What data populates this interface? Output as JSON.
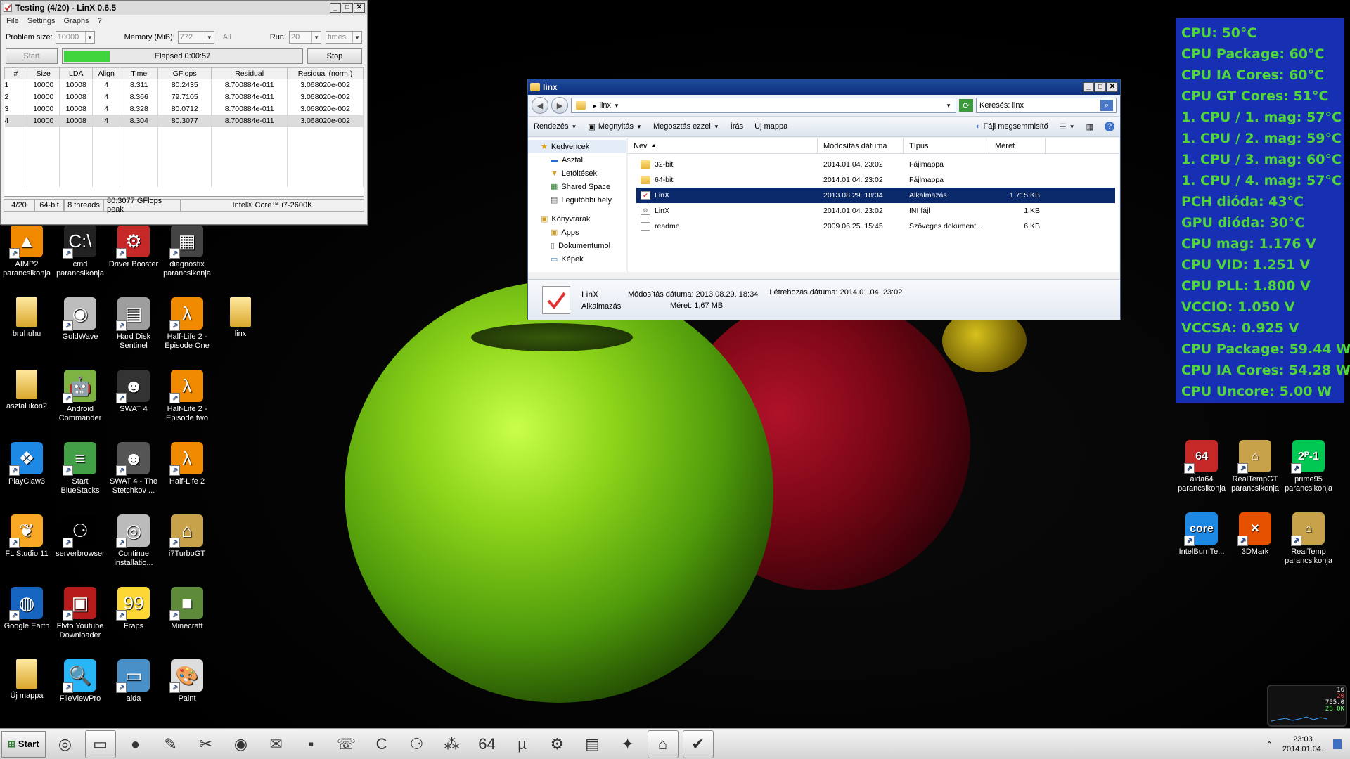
{
  "linx": {
    "title": "Testing (4/20) - LinX 0.6.5",
    "menu": [
      "File",
      "Settings",
      "Graphs",
      "?"
    ],
    "problem_size_label": "Problem size:",
    "problem_size": "10000",
    "memory_label": "Memory (MiB):",
    "memory": "772",
    "all_label": "All",
    "run_label": "Run:",
    "run_value": "20",
    "run_unit": "times",
    "start_label": "Start",
    "stop_label": "Stop",
    "elapsed": "Elapsed 0:00:57",
    "progress": 0.19,
    "columns": [
      "#",
      "Size",
      "LDA",
      "Align",
      "Time",
      "GFlops",
      "Residual",
      "Residual (norm.)"
    ],
    "rows": [
      [
        "1",
        "10000",
        "10008",
        "4",
        "8.311",
        "80.2435",
        "8.700884e-011",
        "3.068020e-002"
      ],
      [
        "2",
        "10000",
        "10008",
        "4",
        "8.366",
        "79.7105",
        "8.700884e-011",
        "3.068020e-002"
      ],
      [
        "3",
        "10000",
        "10008",
        "4",
        "8.328",
        "80.0712",
        "8.700884e-011",
        "3.068020e-002"
      ],
      [
        "4",
        "10000",
        "10008",
        "4",
        "8.304",
        "80.3077",
        "8.700884e-011",
        "3.068020e-002"
      ]
    ],
    "status": [
      "4/20",
      "64-bit",
      "8 threads",
      "80.3077 GFlops peak",
      "Intel® Core™ i7-2600K"
    ]
  },
  "explorer": {
    "title": "linx",
    "address": "linx",
    "search_placeholder": "Keresés: linx",
    "commands": [
      "Rendezés",
      "Megnyitás",
      "Megosztás ezzel",
      "Írás",
      "Új mappa"
    ],
    "burn_label": "Fájl megsemmisítő",
    "nav": {
      "favorites_label": "Kedvencek",
      "favorites": [
        "Asztal",
        "Letöltések",
        "Shared Space",
        "Legutóbbi hely"
      ],
      "libraries_label": "Könyvtárak",
      "libraries": [
        "Apps",
        "Dokumentumol",
        "Képek"
      ]
    },
    "columns": [
      "Név",
      "Módosítás dátuma",
      "Típus",
      "Méret"
    ],
    "files": [
      {
        "name": "32-bit",
        "date": "2014.01.04. 23:02",
        "type": "Fájlmappa",
        "size": "",
        "icon": "folder"
      },
      {
        "name": "64-bit",
        "date": "2014.01.04. 23:02",
        "type": "Fájlmappa",
        "size": "",
        "icon": "folder"
      },
      {
        "name": "LinX",
        "date": "2013.08.29. 18:34",
        "type": "Alkalmazás",
        "size": "1 715 KB",
        "icon": "app"
      },
      {
        "name": "LinX",
        "date": "2014.01.04. 23:02",
        "type": "INI fájl",
        "size": "1 KB",
        "icon": "ini"
      },
      {
        "name": "readme",
        "date": "2009.06.25. 15:45",
        "type": "Szöveges dokument...",
        "size": "6 KB",
        "icon": "txt"
      }
    ],
    "details": {
      "name": "LinX",
      "kind": "Alkalmazás",
      "modified_label": "Módosítás dátuma:",
      "modified": "2013.08.29. 18:34",
      "size_label": "Méret:",
      "size": "1,67 MB",
      "created_label": "Létrehozás dátuma:",
      "created": "2014.01.04. 23:02"
    }
  },
  "sensors": [
    "CPU: 50°C",
    "CPU Package: 60°C",
    "CPU IA Cores: 60°C",
    "CPU GT Cores: 51°C",
    "1. CPU / 1. mag: 57°C",
    "1. CPU / 2. mag: 59°C",
    "1. CPU / 3. mag: 60°C",
    "1. CPU / 4. mag: 57°C",
    "PCH dióda: 43°C",
    "GPU dióda: 30°C",
    "CPU mag: 1.176 V",
    "CPU VID: 1.251 V",
    "CPU PLL: 1.800 V",
    "VCCIO: 1.050 V",
    "VCCSA: 0.925 V",
    "CPU Package: 59.44 W",
    "CPU IA Cores: 54.28 W",
    "CPU Uncore: 5.00 W"
  ],
  "desktop_icons": [
    {
      "label": "AIMP2 parancsikonja",
      "icon": "aimp-icon",
      "glyph": "▲",
      "color": "#f28a00"
    },
    {
      "label": "cmd parancsikonja",
      "icon": "cmd-icon",
      "glyph": "C:\\",
      "color": "#222"
    },
    {
      "label": "Driver Booster",
      "icon": "driver-booster-icon",
      "glyph": "⚙",
      "color": "#c62828"
    },
    {
      "label": "diagnostix parancsikonja",
      "icon": "chip-icon",
      "glyph": "▦",
      "color": "#444"
    },
    {
      "label": "bruhuhu",
      "icon": "folder-icon",
      "glyph": "",
      "color": "#e7c24a"
    },
    {
      "label": "GoldWave",
      "icon": "goldwave-icon",
      "glyph": "◉",
      "color": "#bdbdbd"
    },
    {
      "label": "Hard Disk Sentinel",
      "icon": "hdd-icon",
      "glyph": "▤",
      "color": "#9e9e9e"
    },
    {
      "label": "Half-Life 2 - Episode One",
      "icon": "half-life-icon",
      "glyph": "λ",
      "color": "#f08a00"
    },
    {
      "label": "linx",
      "icon": "folder-icon",
      "glyph": "",
      "color": "#e7c24a"
    },
    {
      "label": "asztal ikon2",
      "icon": "folder-icon",
      "glyph": "",
      "color": "#e7c24a"
    },
    {
      "label": "Android Commander",
      "icon": "android-icon",
      "glyph": "🤖",
      "color": "#7cb342"
    },
    {
      "label": "SWAT 4",
      "icon": "swat-icon",
      "glyph": "☻",
      "color": "#333"
    },
    {
      "label": "Half-Life 2 - Episode two",
      "icon": "half-life-icon",
      "glyph": "λ",
      "color": "#f08a00"
    },
    {
      "label": "PlayClaw3",
      "icon": "playclaw-icon",
      "glyph": "❖",
      "color": "#1e88e5"
    },
    {
      "label": "Start BlueStacks",
      "icon": "bluestacks-icon",
      "glyph": "≡",
      "color": "#43a047"
    },
    {
      "label": "SWAT 4 - The Stetchkov ...",
      "icon": "swat-icon",
      "glyph": "☻",
      "color": "#555"
    },
    {
      "label": "Half-Life 2",
      "icon": "half-life-icon",
      "glyph": "λ",
      "color": "#f08a00"
    },
    {
      "label": "FL Studio 11",
      "icon": "fl-studio-icon",
      "glyph": "❦",
      "color": "#f9a825"
    },
    {
      "label": "serverbrowser",
      "icon": "steam-icon",
      "glyph": "⚆",
      "color": "#000"
    },
    {
      "label": "Continue installatio...",
      "icon": "installer-icon",
      "glyph": "◎",
      "color": "#bbb"
    },
    {
      "label": "i7TurboGT",
      "icon": "i7turbo-icon",
      "glyph": "⌂",
      "color": "#c8a24a"
    },
    {
      "label": "Google Earth",
      "icon": "google-earth-icon",
      "glyph": "◍",
      "color": "#1565c0"
    },
    {
      "label": "Flvto Youtube Downloader",
      "icon": "flvto-icon",
      "glyph": "▣",
      "color": "#b71c1c"
    },
    {
      "label": "Fraps",
      "icon": "fraps-icon",
      "glyph": "99",
      "color": "#fdd835"
    },
    {
      "label": "Minecraft",
      "icon": "minecraft-icon",
      "glyph": "■",
      "color": "#5d8b3a"
    },
    {
      "label": "Új mappa",
      "icon": "folder-icon",
      "glyph": "",
      "color": "#e7c24a"
    },
    {
      "label": "FileViewPro",
      "icon": "fileviewpro-icon",
      "glyph": "🔍",
      "color": "#29b6f6"
    },
    {
      "label": "aida",
      "icon": "image-icon",
      "glyph": "▭",
      "color": "#4a90c8"
    },
    {
      "label": "Paint",
      "icon": "paint-icon",
      "glyph": "🎨",
      "color": "#ddd"
    }
  ],
  "right_icons": [
    {
      "label": "aida64 parancsikonja",
      "icon": "aida64-icon",
      "glyph": "64",
      "color": "#c62828"
    },
    {
      "label": "RealTempGT parancsikonja",
      "icon": "realtemp-icon",
      "glyph": "⌂",
      "color": "#c8a24a"
    },
    {
      "label": "prime95 parancsikonja",
      "icon": "prime95-icon",
      "glyph": "2ᴾ-1",
      "color": "#00c853"
    },
    {
      "label": "IntelBurnTe...",
      "icon": "intel-icon",
      "glyph": "core",
      "color": "#1e88e5"
    },
    {
      "label": "3DMark",
      "icon": "3dmark-icon",
      "glyph": "✕",
      "color": "#e65100"
    },
    {
      "label": "RealTemp parancsikonja",
      "icon": "realtemp-icon",
      "glyph": "⌂",
      "color": "#c8a24a"
    }
  ],
  "taskbar": {
    "start_label": "Start",
    "items": [
      {
        "icon": "network-icon",
        "glyph": "◎"
      },
      {
        "icon": "explorer-icon",
        "glyph": "▭",
        "active": true
      },
      {
        "icon": "firefox-icon",
        "glyph": "●"
      },
      {
        "icon": "paint-icon",
        "glyph": "✎"
      },
      {
        "icon": "tool-icon",
        "glyph": "✂"
      },
      {
        "icon": "chrome-icon",
        "glyph": "◉"
      },
      {
        "icon": "mail-icon",
        "glyph": "✉"
      },
      {
        "icon": "save-icon",
        "glyph": "▪"
      },
      {
        "icon": "viber-icon",
        "glyph": "☏"
      },
      {
        "icon": "ccleaner-icon",
        "glyph": "C"
      },
      {
        "icon": "steam-icon",
        "glyph": "⚆"
      },
      {
        "icon": "network-map-icon",
        "glyph": "⁂"
      },
      {
        "icon": "aida64-icon",
        "glyph": "64"
      },
      {
        "icon": "utorrent-icon",
        "glyph": "µ"
      },
      {
        "icon": "driver-booster-icon",
        "glyph": "⚙"
      },
      {
        "icon": "hdd-icon",
        "glyph": "▤"
      },
      {
        "icon": "tool2-icon",
        "glyph": "✦"
      },
      {
        "icon": "realtemp-icon",
        "glyph": "⌂",
        "active": true
      },
      {
        "icon": "linx-icon",
        "glyph": "✔",
        "active": true
      }
    ],
    "time": "23:03",
    "date": "2014.01.04."
  },
  "gadget": {
    "values": [
      "16",
      "20",
      "755.0",
      "28.0K"
    ]
  }
}
